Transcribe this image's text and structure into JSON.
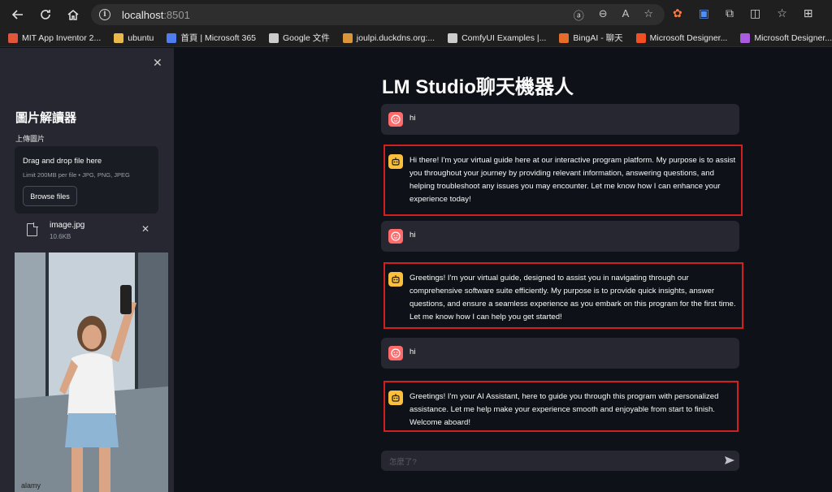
{
  "browser": {
    "url_host": "localhost",
    "url_port": ":8501",
    "bookmarks": [
      {
        "label": "MIT App Inventor 2...",
        "color": "#e0563a"
      },
      {
        "label": "ubuntu",
        "color": "#e9b949"
      },
      {
        "label": "首頁 | Microsoft 365",
        "color": "#4f7df0"
      },
      {
        "label": "Google 文件",
        "color": "#cccccc"
      },
      {
        "label": "joulpi.duckdns.org:...",
        "color": "#d8953a"
      },
      {
        "label": "ComfyUI Examples |...",
        "color": "#cccccc"
      },
      {
        "label": "BingAI - 聊天",
        "color": "#e56c2a"
      },
      {
        "label": "Microsoft Designer...",
        "color": "#f25022"
      },
      {
        "label": "Microsoft Designer...",
        "color": "#a95ce0"
      }
    ]
  },
  "sidebar": {
    "title": "圖片解讀器",
    "upload_label": "上傳圖片",
    "dropzone_title": "Drag and drop file here",
    "dropzone_limit": "Limit 200MB per file • JPG, PNG, JPEG",
    "browse_label": "Browse files",
    "file_name": "image.jpg",
    "file_size": "10.6KB"
  },
  "main": {
    "title": "LM Studio聊天機器人",
    "messages": [
      {
        "role": "user",
        "text": "hi"
      },
      {
        "role": "assistant",
        "text": "Hi there! I'm your virtual guide here at our interactive program platform. My purpose is to assist you throughout your journey by providing relevant information, answering questions, and helping troubleshoot any issues you may encounter. Let me know how I can enhance your experience today!"
      },
      {
        "role": "user",
        "text": "hi"
      },
      {
        "role": "assistant",
        "text": "Greetings! I'm your virtual guide, designed to assist you in navigating through our comprehensive software suite efficiently. My purpose is to provide quick insights, answer questions, and ensure a seamless experience as you embark on this program for the first time. Let me know how I can help you get started!"
      },
      {
        "role": "user",
        "text": "hi"
      },
      {
        "role": "assistant",
        "text": "Greetings! I'm your AI Assistant, here to guide you through this program with personalized assistance. Let me help make your experience smooth and enjoyable from start to finish. Welcome aboard!"
      }
    ],
    "input_placeholder": "怎麼了?"
  },
  "colors": {
    "user_avatar": "#ff6b6b",
    "bot_avatar": "#fbbf3c",
    "highlight_box": "#d21f1f"
  }
}
